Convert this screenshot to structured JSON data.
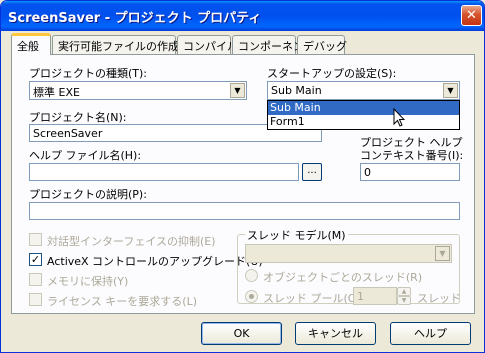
{
  "window": {
    "title": "ScreenSaver - プロジェクト プロパティ",
    "close_glyph": "✕"
  },
  "tabs": [
    {
      "label": "全般",
      "active": true
    },
    {
      "label": "実行可能ファイルの作成",
      "active": false
    },
    {
      "label": "コンパイル",
      "active": false
    },
    {
      "label": "コンポーネント",
      "active": false
    },
    {
      "label": "デバッグ",
      "active": false
    }
  ],
  "general": {
    "project_type_label": "プロジェクトの種類(T):",
    "project_type_value": "標準 EXE",
    "startup_label": "スタートアップの設定(S):",
    "startup_value": "Sub Main",
    "startup_options": [
      "Sub Main",
      "Form1"
    ],
    "startup_highlighted": "Sub Main",
    "project_name_label": "プロジェクト名(N):",
    "project_name_value": "ScreenSaver",
    "help_file_label": "ヘルプ ファイル名(H):",
    "help_file_value": "",
    "browse_label": "...",
    "help_context_label_1": "プロジェクト ヘルプ",
    "help_context_label_2": "コンテキスト番号(I):",
    "help_context_value": "0",
    "description_label": "プロジェクトの説明(P):",
    "description_value": "",
    "unattended_label": "対話型インターフェイスの抑制(E)",
    "unattended_checked": false,
    "upgrade_activex_label": "ActiveX コントロールのアップグレード(U)",
    "upgrade_activex_checked": true,
    "retained_label": "メモリに保持(Y)",
    "retained_checked": false,
    "license_key_label": "ライセンス キーを要求する(L)",
    "license_key_checked": false,
    "threading_group_label": "スレッド モデル(M)",
    "threading_model_value": "",
    "thread_per_object_label": "オブジェクトごとのスレッド(R)",
    "thread_pool_label": "スレッド プール(O)",
    "thread_pool_value": "1",
    "thread_pool_unit": "スレッド"
  },
  "buttons": {
    "ok": "OK",
    "cancel": "キャンセル",
    "help": "ヘルプ"
  },
  "colors": {
    "titlebar": "#0053ee",
    "selection": "#316ac5"
  }
}
